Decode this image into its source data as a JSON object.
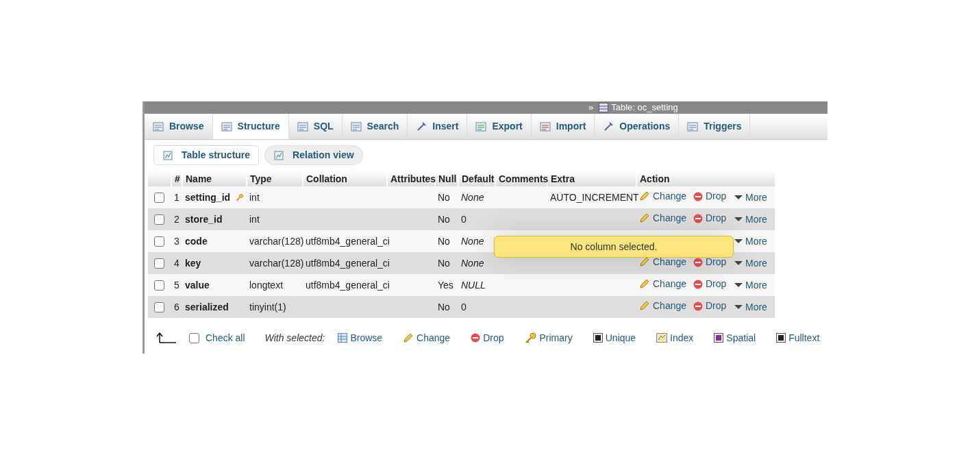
{
  "breadcrumb": {
    "separator": "»",
    "table": "Table: oc_setting"
  },
  "tabs": [
    {
      "label": "Browse",
      "selected": false
    },
    {
      "label": "Structure",
      "selected": true
    },
    {
      "label": "SQL",
      "selected": false
    },
    {
      "label": "Search",
      "selected": false
    },
    {
      "label": "Insert",
      "selected": false
    },
    {
      "label": "Export",
      "selected": false
    },
    {
      "label": "Import",
      "selected": false
    },
    {
      "label": "Operations",
      "selected": false
    },
    {
      "label": "Triggers",
      "selected": false
    }
  ],
  "subtabs": [
    {
      "label": "Table structure",
      "selected": true
    },
    {
      "label": "Relation view",
      "selected": false
    }
  ],
  "table": {
    "columns": [
      "#",
      "Name",
      "Type",
      "Collation",
      "Attributes",
      "Null",
      "Default",
      "Comments",
      "Extra",
      "Action"
    ],
    "rows": [
      {
        "checked": false,
        "num": "1",
        "name": "setting_id",
        "primary": true,
        "type": "int",
        "null": "No",
        "default": "None",
        "default_italic": true,
        "extra": "AUTO_INCREMENT",
        "actions": [
          {
            "kind": "change",
            "label": "Change"
          },
          {
            "kind": "drop",
            "label": "Drop"
          },
          {
            "kind": "more",
            "label": "More"
          }
        ]
      },
      {
        "checked": false,
        "num": "2",
        "name": "store_id",
        "primary": false,
        "type": "int",
        "null": "No",
        "default": "0",
        "default_italic": false,
        "actions": [
          {
            "kind": "change",
            "label": "Change"
          },
          {
            "kind": "drop",
            "label": "Drop"
          },
          {
            "kind": "more",
            "label": "More"
          }
        ]
      },
      {
        "checked": false,
        "num": "3",
        "name": "code",
        "primary": false,
        "type": "varchar(128)",
        "collation": "utf8mb4_general_ci",
        "null": "No",
        "default": "None",
        "default_italic": true,
        "actions": [
          {
            "kind": "more",
            "label": "More"
          }
        ]
      },
      {
        "checked": false,
        "num": "4",
        "name": "key",
        "primary": false,
        "type": "varchar(128)",
        "collation": "utf8mb4_general_ci",
        "null": "No",
        "default": "None",
        "default_italic": true,
        "actions": [
          {
            "kind": "change",
            "label": "Change"
          },
          {
            "kind": "drop",
            "label": "Drop"
          },
          {
            "kind": "more",
            "label": "More"
          }
        ]
      },
      {
        "checked": false,
        "num": "5",
        "name": "value",
        "primary": false,
        "type": "longtext",
        "collation": "utf8mb4_general_ci",
        "null": "Yes",
        "default": "NULL",
        "default_italic": true,
        "actions": [
          {
            "kind": "change",
            "label": "Change"
          },
          {
            "kind": "drop",
            "label": "Drop"
          },
          {
            "kind": "more",
            "label": "More"
          }
        ]
      },
      {
        "checked": false,
        "num": "6",
        "name": "serialized",
        "primary": false,
        "type": "tinyint(1)",
        "null": "No",
        "default": "0",
        "default_italic": false,
        "actions": [
          {
            "kind": "change",
            "label": "Change"
          },
          {
            "kind": "drop",
            "label": "Drop"
          },
          {
            "kind": "more",
            "label": "More"
          }
        ]
      }
    ]
  },
  "tooltip": "No column selected.",
  "footer": {
    "check_all": {
      "label": "Check all",
      "checked": false
    },
    "with_selected": "With selected:",
    "actions": [
      {
        "kind": "browse",
        "label": "Browse"
      },
      {
        "kind": "change",
        "label": "Change"
      },
      {
        "kind": "drop",
        "label": "Drop"
      },
      {
        "kind": "primary",
        "label": "Primary"
      },
      {
        "kind": "unique",
        "label": "Unique"
      },
      {
        "kind": "index",
        "label": "Index"
      },
      {
        "kind": "spatial",
        "label": "Spatial"
      },
      {
        "kind": "fulltext",
        "label": "Fulltext"
      }
    ]
  }
}
